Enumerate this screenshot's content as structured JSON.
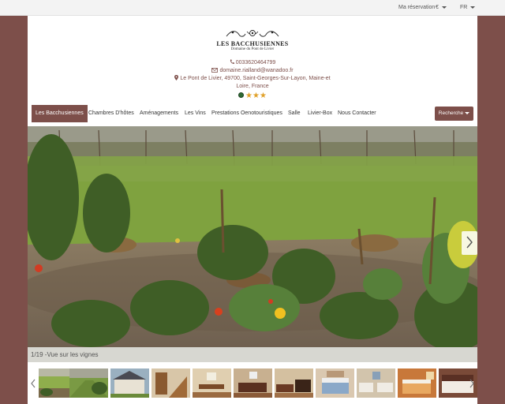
{
  "topbar": {
    "reservation": "Ma réservation",
    "currency": "€",
    "language": "FR"
  },
  "logo": {
    "title": "LES BACCHUSIENNES",
    "subtitle": "Domaine du Pont de Livier"
  },
  "contact": {
    "phone": "0033620464799",
    "email": "domaine.rialland@wanadoo.fr",
    "address_line1": "Le Pont de Livier, 49700, Saint-Georges-Sur-Layon, Maine-et",
    "address_line2": "Loire, France",
    "stars": 3
  },
  "nav": {
    "items": [
      {
        "label": "Les Bacchusiennes",
        "active": true
      },
      {
        "label": "Chambres D'hôtes"
      },
      {
        "label": "Aménagements"
      },
      {
        "label": "Les Vins"
      },
      {
        "label": "Prestations Oenotouristiques"
      },
      {
        "label": "Salle"
      },
      {
        "label": "Livier-Box"
      },
      {
        "label": "Nous Contacter"
      }
    ],
    "search_label": "Recherche"
  },
  "gallery": {
    "caption": "1/19 -Vue sur les vignes",
    "thumbnails": [
      {
        "subject": "vineyard"
      },
      {
        "subject": "vineyard-rows"
      },
      {
        "subject": "house-exterior"
      },
      {
        "subject": "interior-stairs"
      },
      {
        "subject": "dining-room"
      },
      {
        "subject": "living-room"
      },
      {
        "subject": "dining-living"
      },
      {
        "subject": "bedroom-blue"
      },
      {
        "subject": "bedroom-twin"
      },
      {
        "subject": "bedroom-orange"
      },
      {
        "subject": "bedroom-dark"
      }
    ]
  },
  "colors": {
    "brand": "#7d4f4a",
    "star": "#e0a12a"
  }
}
